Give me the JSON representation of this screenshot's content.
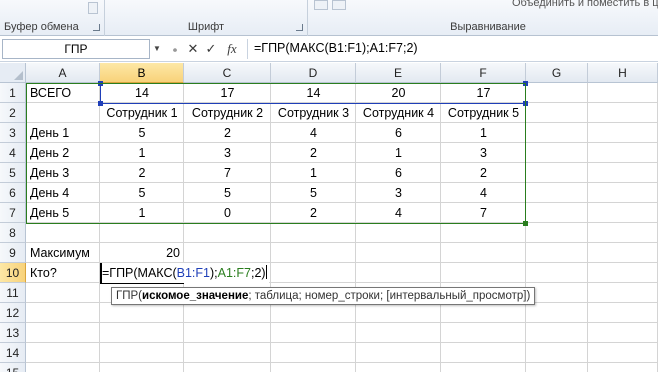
{
  "ribbon": {
    "clipboard_label": "Буфер обмена",
    "font_label": "Шрифт",
    "alignment_label": "Выравнивание",
    "merge_text": "Объединить и поместить в центре"
  },
  "formula_bar": {
    "name_box": "ГПР",
    "cancel_icon": "✕",
    "enter_icon": "✓",
    "fx_label": "fx",
    "formula": "=ГПР(МАКС(B1:F1);A1:F7;2)"
  },
  "columns": [
    "A",
    "B",
    "C",
    "D",
    "E",
    "F",
    "G",
    "H"
  ],
  "rows": [
    "1",
    "2",
    "3",
    "4",
    "5",
    "6",
    "7",
    "8",
    "9",
    "10",
    "11",
    "12",
    "13",
    "14",
    "15"
  ],
  "cells": {
    "A1": "ВСЕГО",
    "B1": "14",
    "C1": "17",
    "D1": "14",
    "E1": "20",
    "F1": "17",
    "B2": "Сотрудник 1",
    "C2": "Сотрудник 2",
    "D2": "Сотрудник 3",
    "E2": "Сотрудник 4",
    "F2": "Сотрудник 5",
    "A3": "День 1",
    "B3": "5",
    "C3": "2",
    "D3": "4",
    "E3": "6",
    "F3": "1",
    "A4": "День 2",
    "B4": "1",
    "C4": "3",
    "D4": "2",
    "E4": "1",
    "F4": "3",
    "A5": "День 3",
    "B5": "2",
    "C5": "7",
    "D5": "1",
    "E5": "6",
    "F5": "2",
    "A6": "День 4",
    "B6": "5",
    "C6": "5",
    "D6": "5",
    "E6": "3",
    "F6": "4",
    "A7": "День 5",
    "B7": "1",
    "C7": "0",
    "D7": "2",
    "E7": "4",
    "F7": "7",
    "A9": "Максимум",
    "B9": "20",
    "A10": "Кто?"
  },
  "edit": {
    "prefix": "=ГПР(МАКС(",
    "ref1": "B1:F1",
    "mid": ");",
    "ref2": "A1:F7",
    "suffix": ";2)"
  },
  "tooltip": {
    "func": "ГПР(",
    "arg_active": "искомое_значение",
    "rest": "; таблица; номер_строки; [интервальный_просмотр])"
  },
  "colors": {
    "range1": "#1f3fb8",
    "range2": "#2a7d1e",
    "header_selected": "#f8d27a"
  }
}
